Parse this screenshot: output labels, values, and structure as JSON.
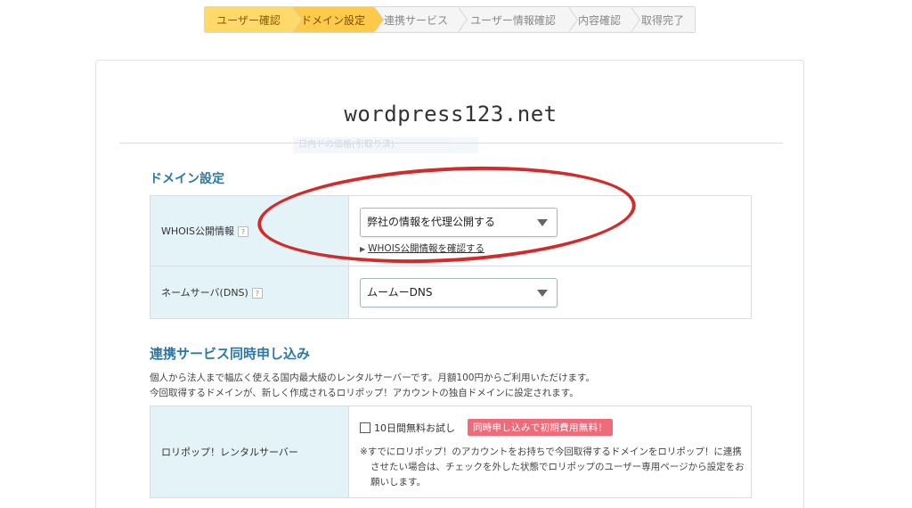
{
  "steps": [
    {
      "label": "ユーザー確認",
      "state": "done"
    },
    {
      "label": "ドメイン設定",
      "state": "current"
    },
    {
      "label": "連携サービス",
      "state": "todo"
    },
    {
      "label": "ユーザー情報確認",
      "state": "todo"
    },
    {
      "label": "内容確認",
      "state": "todo"
    },
    {
      "label": "取得完了",
      "state": "todo"
    }
  ],
  "domain": "wordpress123.net",
  "faint_text": "日内ドの価格(引取り済)",
  "domain_settings": {
    "title": "ドメイン設定",
    "whois": {
      "label": "WHOIS公開情報",
      "help": "?",
      "selected": "弊社の情報を代理公開する",
      "link_marker": "▶",
      "link_text": "WHOIS公開情報を確認する"
    },
    "dns": {
      "label": "ネームサーバ(DNS)",
      "help": "?",
      "selected": "ムームーDNS"
    }
  },
  "linked_services": {
    "title": "連携サービス同時申し込み",
    "desc_line1": "個人から法人まで幅広く使える国内最大級のレンタルサーバーです。月額100円からご利用いただけます。",
    "desc_line2": "今回取得するドメインが、新しく作成されるロリポップ！アカウントの独自ドメインに設定されます。",
    "lolipop": {
      "label": "ロリポップ！レンタルサーバー",
      "trial_label": "10日間無料お試し",
      "badge": "同時申し込みで初期費用無料！",
      "note": "※すでにロリポップ！のアカウントをお持ちで今回取得するドメインをロリポップ！に連携させたい場合は、チェックを外した状態でロリポップのユーザー専用ページから設定をお願いします。"
    }
  },
  "colors": {
    "step_done": "#ffd96a",
    "step_current": "#ffca4a",
    "section_title": "#2a7aa8",
    "label_cell": "#e3f3f8",
    "badge": "#f06b7a",
    "annotation_circle": "#d42a2a"
  },
  "icons": {
    "help": "question-mark-icon",
    "select_caret": "triangle-down-icon",
    "link_marker": "triangle-right-icon"
  }
}
